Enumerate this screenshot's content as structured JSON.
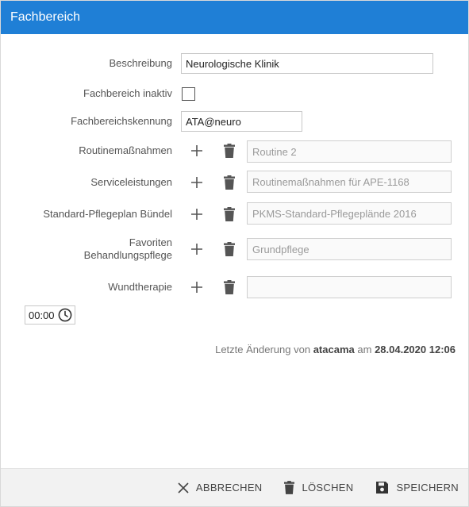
{
  "dialog": {
    "title": "Fachbereich"
  },
  "form": {
    "beschreibung": {
      "label": "Beschreibung",
      "value": "Neurologische Klinik"
    },
    "inaktiv": {
      "label": "Fachbereich inaktiv",
      "checked": false
    },
    "kennung": {
      "label": "Fachbereichskennung",
      "value": "ATA@neuro"
    },
    "routinemassnahmen": {
      "label": "Routinemaßnahmen",
      "value": "Routine 2"
    },
    "serviceleistungen": {
      "label": "Serviceleistungen",
      "value": "Routinemaßnahmen für APE-1168"
    },
    "pflegeplan": {
      "label": "Standard-Pflegeplan Bündel",
      "value": "PKMS-Standard-Pflegeplände 2016"
    },
    "favoriten": {
      "label_line1": "Favoriten",
      "label_line2": "Behandlungspflege",
      "value": "Grundpflege"
    },
    "wundtherapie": {
      "label": "Wundtherapie",
      "value": ""
    }
  },
  "time": {
    "value": "00:00"
  },
  "last_change": {
    "prefix": "Letzte Änderung von",
    "user": "atacama",
    "mid": "am",
    "datetime": "28.04.2020 12:06"
  },
  "footer": {
    "cancel_label": "ABBRECHEN",
    "delete_label": "LÖSCHEN",
    "save_label": "SPEICHERN"
  },
  "icons": {
    "add": "plus-icon",
    "delete": "trash-icon",
    "cancel": "close-icon",
    "save": "floppy-disk-icon",
    "time": "clock-icon"
  },
  "colors": {
    "header": "#1f7fd6",
    "footer": "#f2f2f2",
    "icon": "#555555"
  }
}
